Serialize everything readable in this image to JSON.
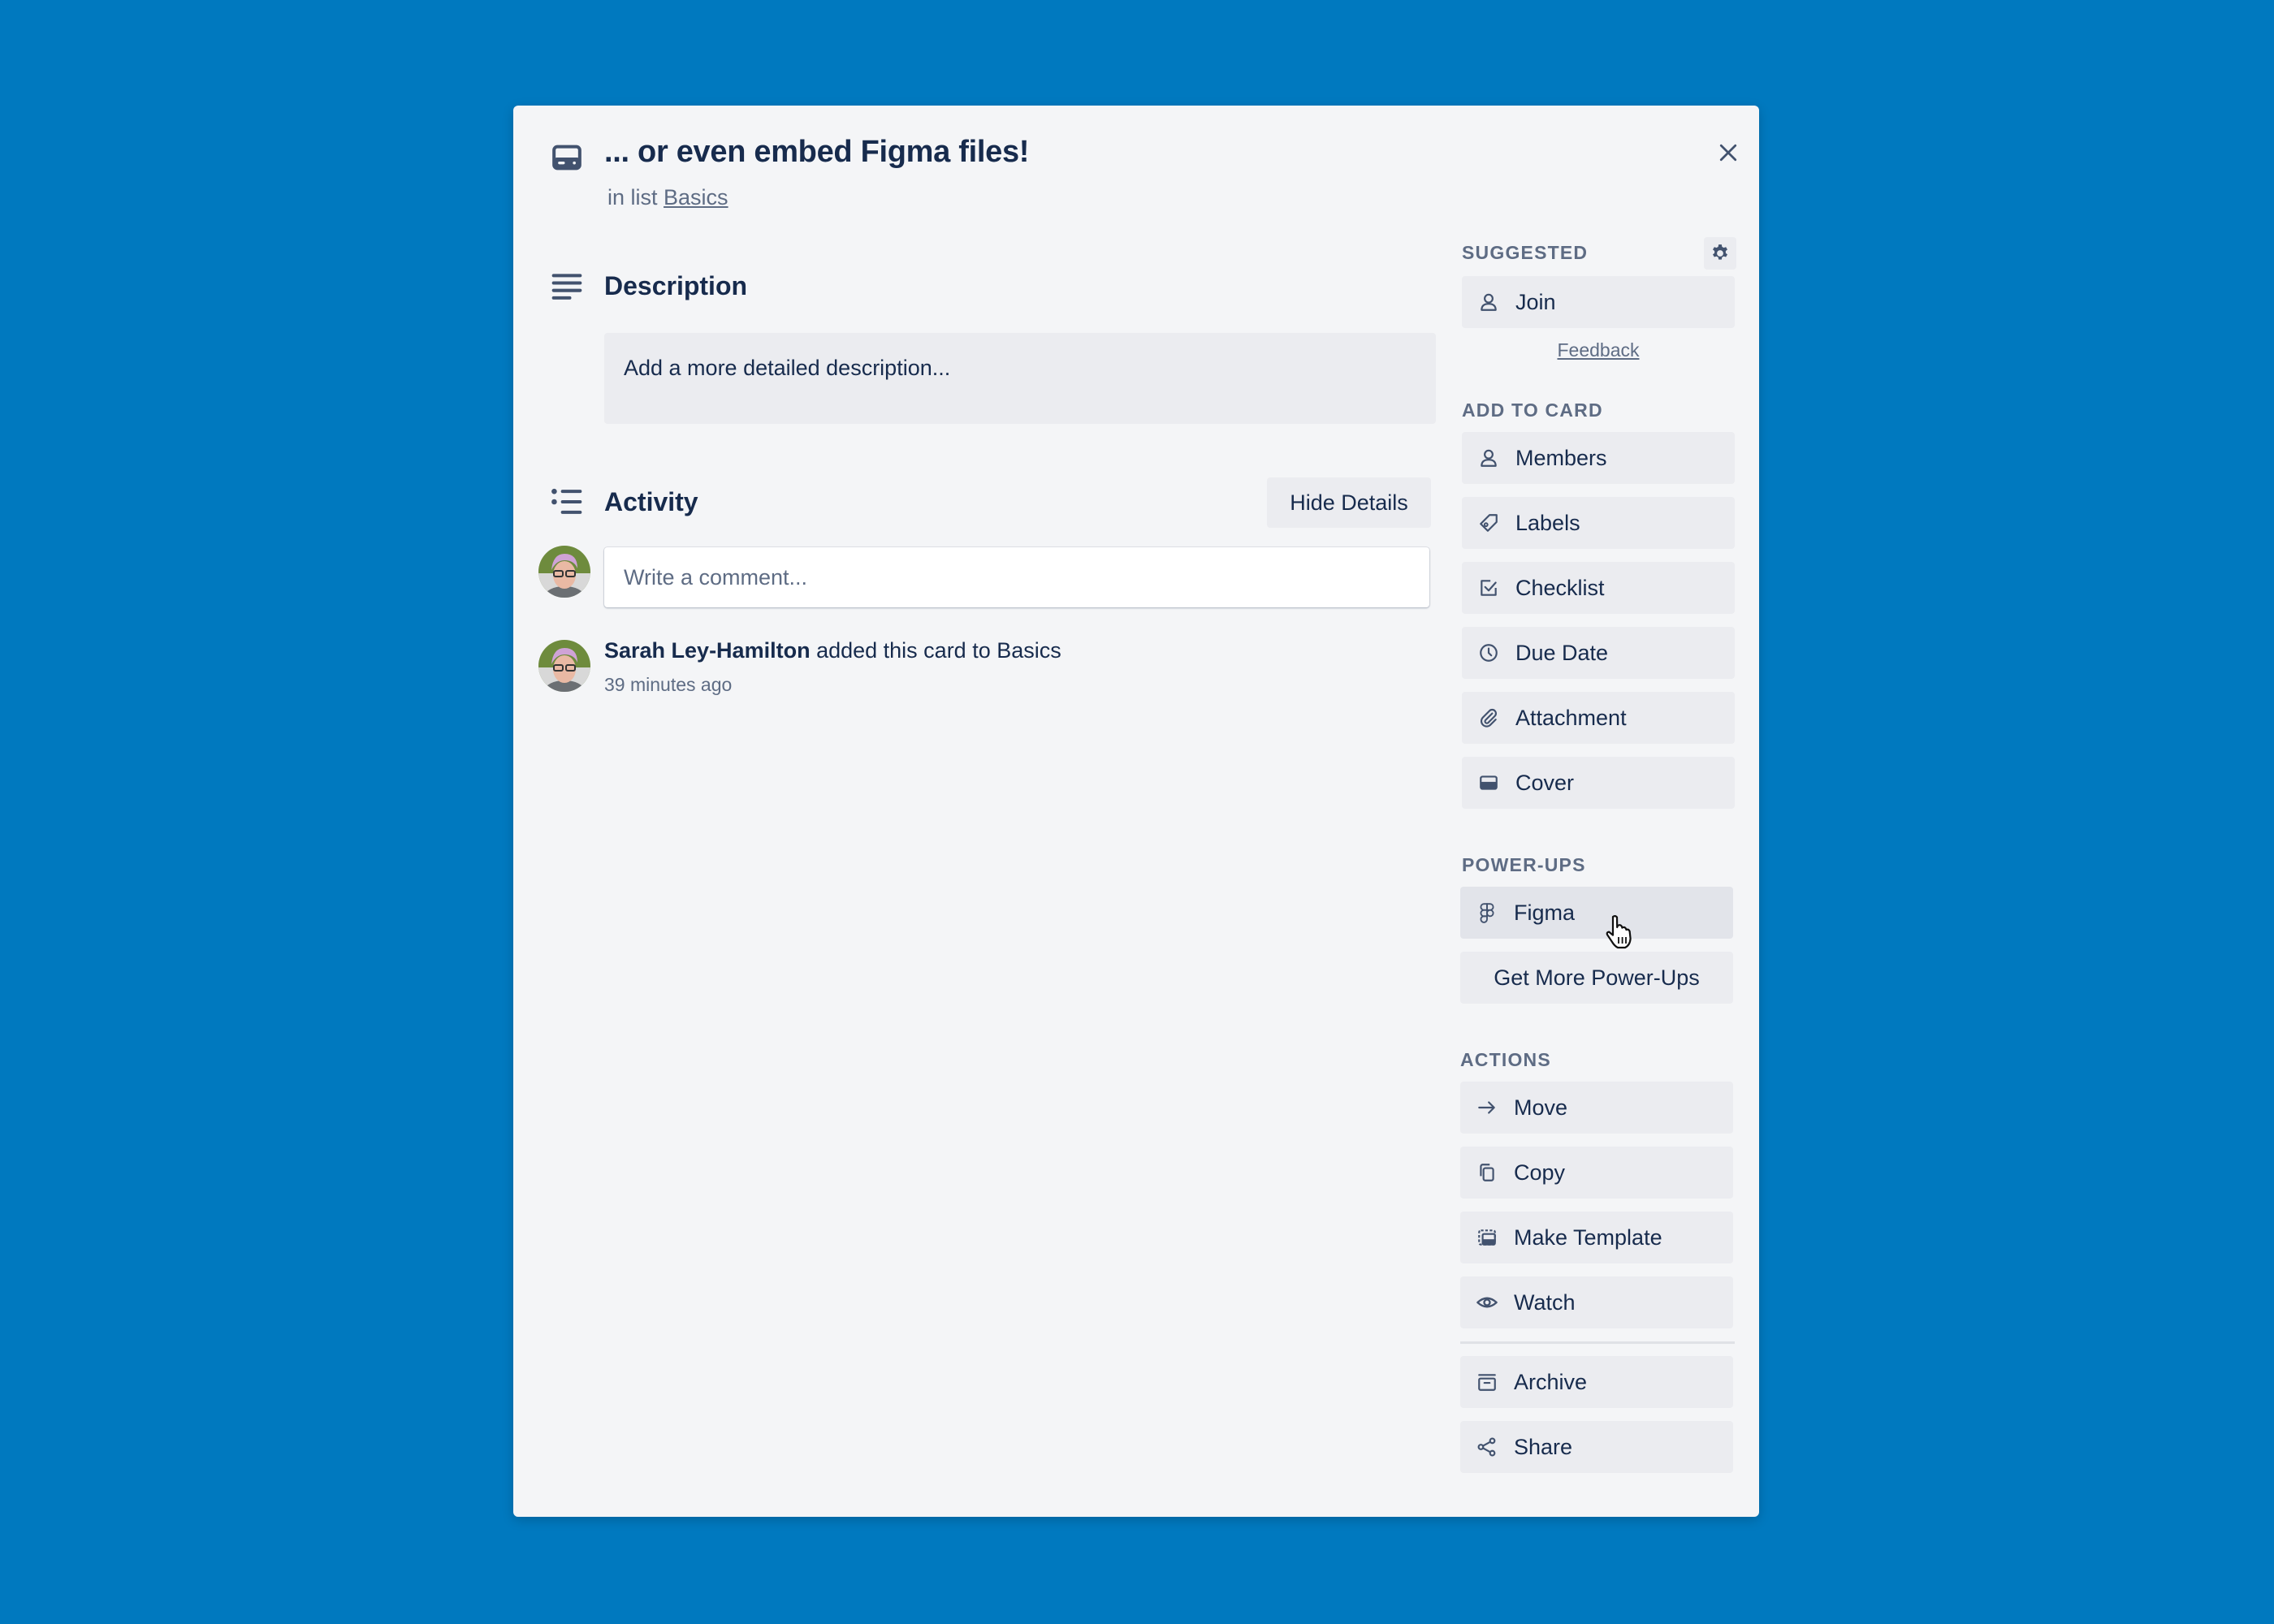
{
  "card": {
    "title": "... or even embed Figma files!",
    "in_list_prefix": "in list",
    "list_name": "Basics",
    "close_icon": "close-icon",
    "card_icon": "card-icon"
  },
  "description": {
    "heading": "Description",
    "placeholder": "Add a more detailed description...",
    "icon": "description-icon"
  },
  "activity": {
    "heading": "Activity",
    "icon": "activity-icon",
    "hide_details_label": "Hide Details",
    "comment_placeholder": "Write a comment...",
    "entries": [
      {
        "user": "Sarah Ley-Hamilton",
        "action": "added this card to Basics",
        "time": "39 minutes ago"
      }
    ]
  },
  "sidebar": {
    "suggested": {
      "label": "Suggested",
      "settings_icon": "gear-icon",
      "join_label": "Join",
      "feedback_label": "Feedback"
    },
    "add_to_card": {
      "label": "Add to card",
      "items": [
        {
          "label": "Members",
          "icon": "member-icon"
        },
        {
          "label": "Labels",
          "icon": "label-icon"
        },
        {
          "label": "Checklist",
          "icon": "checklist-icon"
        },
        {
          "label": "Due Date",
          "icon": "clock-icon"
        },
        {
          "label": "Attachment",
          "icon": "paperclip-icon"
        },
        {
          "label": "Cover",
          "icon": "cover-icon"
        }
      ]
    },
    "power_ups": {
      "label": "Power-Ups",
      "items": [
        {
          "label": "Figma",
          "icon": "figma-icon"
        }
      ],
      "get_more_label": "Get More Power-Ups"
    },
    "actions": {
      "label": "Actions",
      "items": [
        {
          "label": "Move",
          "icon": "arrow-right-icon"
        },
        {
          "label": "Copy",
          "icon": "copy-icon"
        },
        {
          "label": "Make Template",
          "icon": "template-icon"
        },
        {
          "label": "Watch",
          "icon": "eye-icon"
        },
        {
          "label": "Archive",
          "icon": "archive-icon"
        },
        {
          "label": "Share",
          "icon": "share-icon"
        }
      ]
    }
  },
  "colors": {
    "board_background": "#0079bf",
    "modal_background": "#f4f5f7",
    "button_background": "#ebecf0",
    "text_primary": "#172b4d",
    "text_secondary": "#5e6c84"
  }
}
